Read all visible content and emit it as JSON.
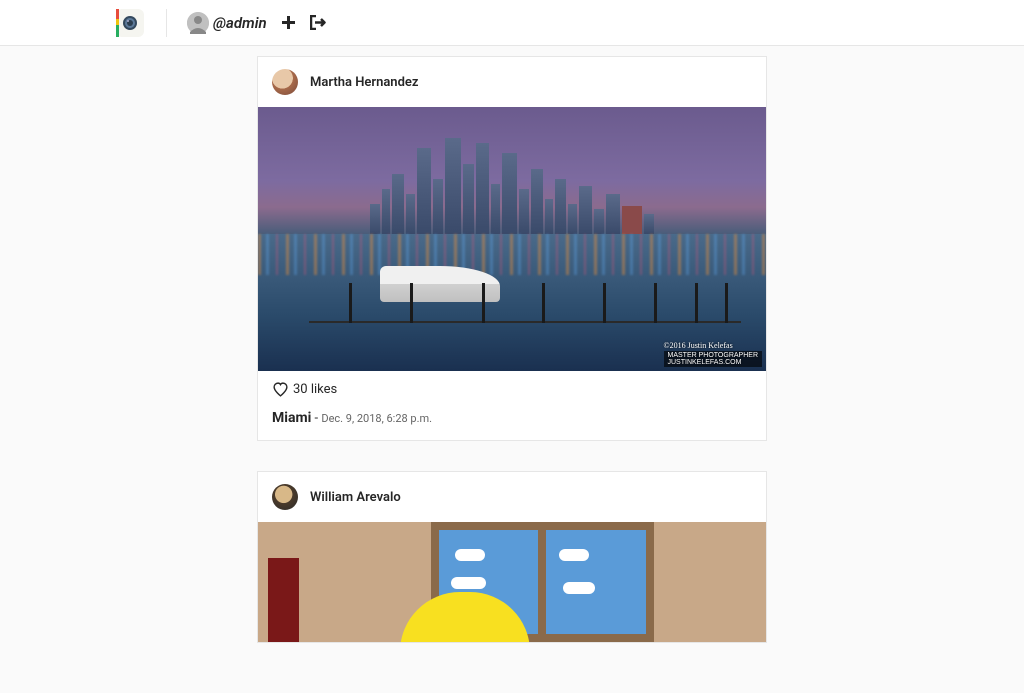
{
  "navbar": {
    "username": "@admin"
  },
  "posts": [
    {
      "author": "Martha Hernandez",
      "likes_text": "30 likes",
      "caption_title": "Miami",
      "caption_date": "Dec. 9, 2018, 6:28 p.m."
    },
    {
      "author": "William Arevalo"
    }
  ]
}
